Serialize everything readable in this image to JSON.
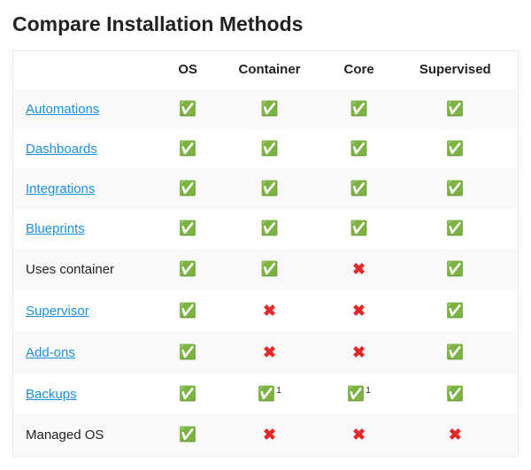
{
  "title": "Compare Installation Methods",
  "columns": {
    "c0": "",
    "c1": "OS",
    "c2": "Container",
    "c3": "Core",
    "c4": "Supervised"
  },
  "chart_data": {
    "type": "table",
    "title": "Compare Installation Methods",
    "columns": [
      "Feature",
      "OS",
      "Container",
      "Core",
      "Supervised"
    ],
    "rows": [
      {
        "feature": "Automations",
        "link": true,
        "values": [
          "yes",
          "yes",
          "yes",
          "yes"
        ]
      },
      {
        "feature": "Dashboards",
        "link": true,
        "values": [
          "yes",
          "yes",
          "yes",
          "yes"
        ]
      },
      {
        "feature": "Integrations",
        "link": true,
        "values": [
          "yes",
          "yes",
          "yes",
          "yes"
        ]
      },
      {
        "feature": "Blueprints",
        "link": true,
        "values": [
          "yes",
          "yes",
          "yes",
          "yes"
        ]
      },
      {
        "feature": "Uses container",
        "link": false,
        "values": [
          "yes",
          "yes",
          "no",
          "yes"
        ]
      },
      {
        "feature": "Supervisor",
        "link": true,
        "values": [
          "yes",
          "no",
          "no",
          "yes"
        ]
      },
      {
        "feature": "Add-ons",
        "link": true,
        "values": [
          "yes",
          "no",
          "no",
          "yes"
        ]
      },
      {
        "feature": "Backups",
        "link": true,
        "values": [
          "yes",
          "yes",
          "yes",
          "yes"
        ],
        "notes": {
          "1": "1",
          "2": "1"
        }
      },
      {
        "feature": "Managed OS",
        "link": false,
        "values": [
          "yes",
          "no",
          "no",
          "no"
        ]
      }
    ]
  },
  "icons": {
    "yes": "✅",
    "no": "✖"
  }
}
